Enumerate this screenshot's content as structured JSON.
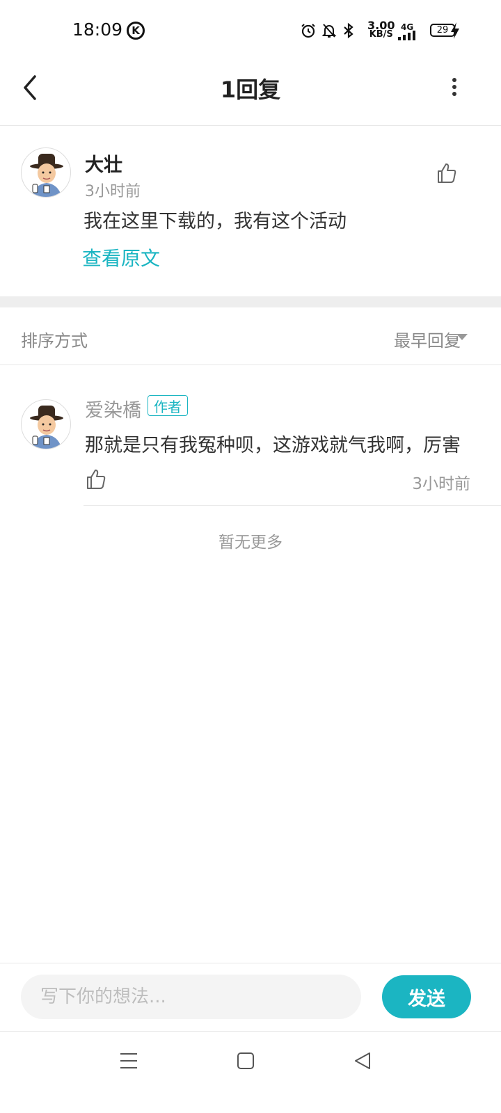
{
  "status_bar": {
    "time": "18:09",
    "k_icon": "K",
    "speed_value": "3.00",
    "speed_unit": "KB/S",
    "network": "4G",
    "battery": "29"
  },
  "header": {
    "title": "1回复"
  },
  "main_comment": {
    "username": "大壮",
    "time": "3小时前",
    "content": "我在这里下载的，我有这个活动",
    "view_original": "查看原文"
  },
  "sort": {
    "label": "排序方式",
    "value": "最早回复"
  },
  "reply": {
    "username": "爱染橋",
    "badge": "作者",
    "content": "那就是只有我冤种呗，这游戏就气我啊，厉害",
    "time": "3小时前"
  },
  "no_more": "暂无更多",
  "input": {
    "placeholder": "写下你的想法...",
    "send_label": "发送"
  },
  "colors": {
    "accent": "#1bb5c2",
    "text_primary": "#222222",
    "text_secondary": "#999999"
  },
  "icons": [
    "back-arrow-icon",
    "more-vertical-icon",
    "thumb-up-icon",
    "chevron-down-icon",
    "alarm-icon",
    "bell-off-icon",
    "bluetooth-icon",
    "signal-icon",
    "battery-icon",
    "charging-icon",
    "menu-icon",
    "home-square-icon",
    "back-triangle-icon"
  ]
}
